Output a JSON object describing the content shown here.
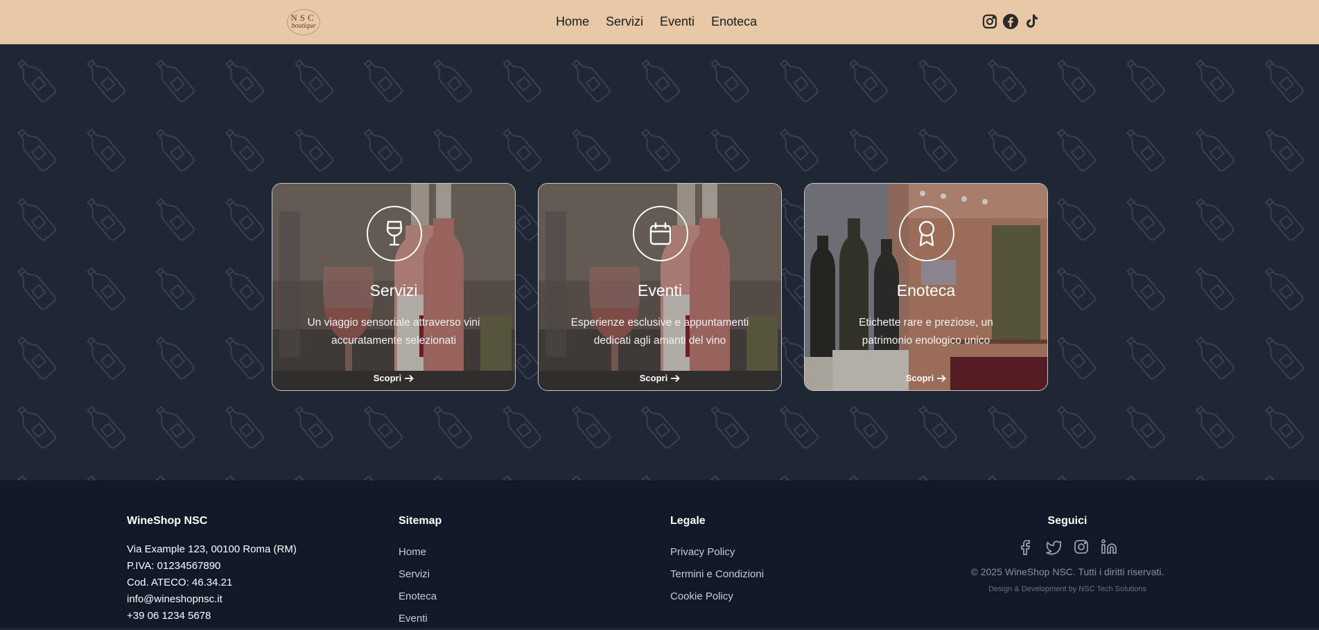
{
  "header": {
    "logo_line1": "NSC",
    "logo_line2": "boutique",
    "nav": [
      "Home",
      "Servizi",
      "Eventi",
      "Enoteca"
    ],
    "social_icons": [
      "instagram-icon",
      "facebook-icon",
      "tiktok-icon"
    ]
  },
  "cards": [
    {
      "title": "Servizi",
      "desc": "Un viaggio sensoriale attraverso vini accuratamente selezionati",
      "cta": "Scopri",
      "icon": "wine-glass-icon"
    },
    {
      "title": "Eventi",
      "desc": "Esperienze esclusive e appuntamenti dedicati agli amanti del vino",
      "cta": "Scopri",
      "icon": "calendar-icon"
    },
    {
      "title": "Enoteca",
      "desc": "Etichette rare e preziose, un patrimonio enologico unico",
      "cta": "Scopri",
      "icon": "award-icon"
    }
  ],
  "footer": {
    "company": {
      "heading": "WineShop NSC",
      "lines": [
        "Via Example 123, 00100 Roma (RM)",
        "P.IVA: 01234567890",
        "Cod. ATECO: 46.34.21",
        "info@wineshopnsc.it",
        "+39 06 1234 5678"
      ]
    },
    "sitemap": {
      "heading": "Sitemap",
      "links": [
        "Home",
        "Servizi",
        "Enoteca",
        "Eventi"
      ]
    },
    "legal": {
      "heading": "Legale",
      "links": [
        "Privacy Policy",
        "Termini e Condizioni",
        "Cookie Policy"
      ]
    },
    "follow": {
      "heading": "Seguici",
      "icons": [
        "facebook-icon",
        "twitter-icon",
        "instagram-icon",
        "linkedin-icon"
      ],
      "copyright": "© 2025 WineShop NSC. Tutti i diritti riservati.",
      "credit": "Design & Development by NSC Tech Solutions"
    }
  },
  "colors": {
    "header_bg": "#e8c8a6",
    "hero_bg": "#1f2735",
    "footer_bg": "#111827"
  }
}
